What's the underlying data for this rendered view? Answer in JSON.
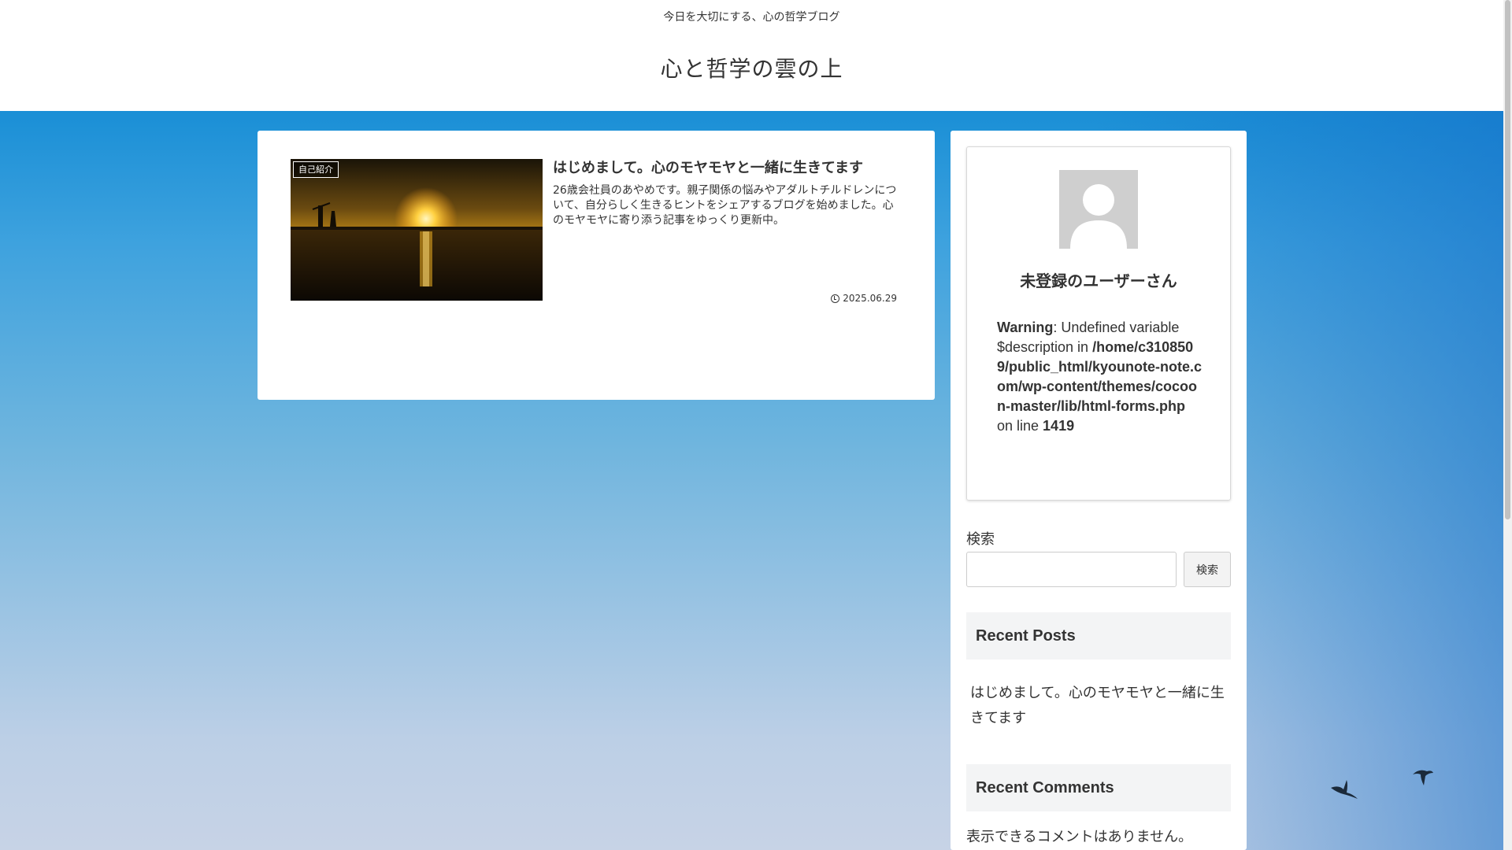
{
  "header": {
    "tagline": "今日を大切にする、心の哲学ブログ",
    "site_title": "心と哲学の雲の上"
  },
  "main": {
    "entry": {
      "category": "自己紹介",
      "title": "はじめまして。心のモヤモヤと一緒に生きてます",
      "snippet": "26歳会社員のあやめです。親子関係の悩みやアダルトチルドレンについて、自分らしく生きるヒントをシェアするブログを始めました。心のモヤモヤに寄り添う記事をゆっくり更新中。",
      "date": "2025.06.29",
      "thumbnail_icon": "sunset-photo"
    }
  },
  "sidebar": {
    "profile": {
      "avatar_icon": "user-placeholder-icon",
      "name": "未登録のユーザーさん",
      "warning_label": "Warning",
      "warning_text": ": Undefined variable $description in ",
      "warning_path": "/home/c3108509/public_html/kyounote-note.com/wp-content/themes/cocoon-master/lib/html-forms.php",
      "warning_on_line": " on line ",
      "warning_line": "1419"
    },
    "search": {
      "label": "検索",
      "input_value": "",
      "button_label": "検索"
    },
    "recent_posts": {
      "heading": "Recent Posts",
      "items": [
        "はじめまして。心のモヤモヤと一緒に生きてます"
      ]
    },
    "recent_comments": {
      "heading": "Recent Comments",
      "empty_text": "表示できるコメントはありません。"
    }
  },
  "colors": {
    "sky_top": "#1a8fd6",
    "sky_bottom": "#c7d3e6",
    "card_bg": "#ffffff",
    "widget_heading_bg": "#f3f4f5"
  }
}
